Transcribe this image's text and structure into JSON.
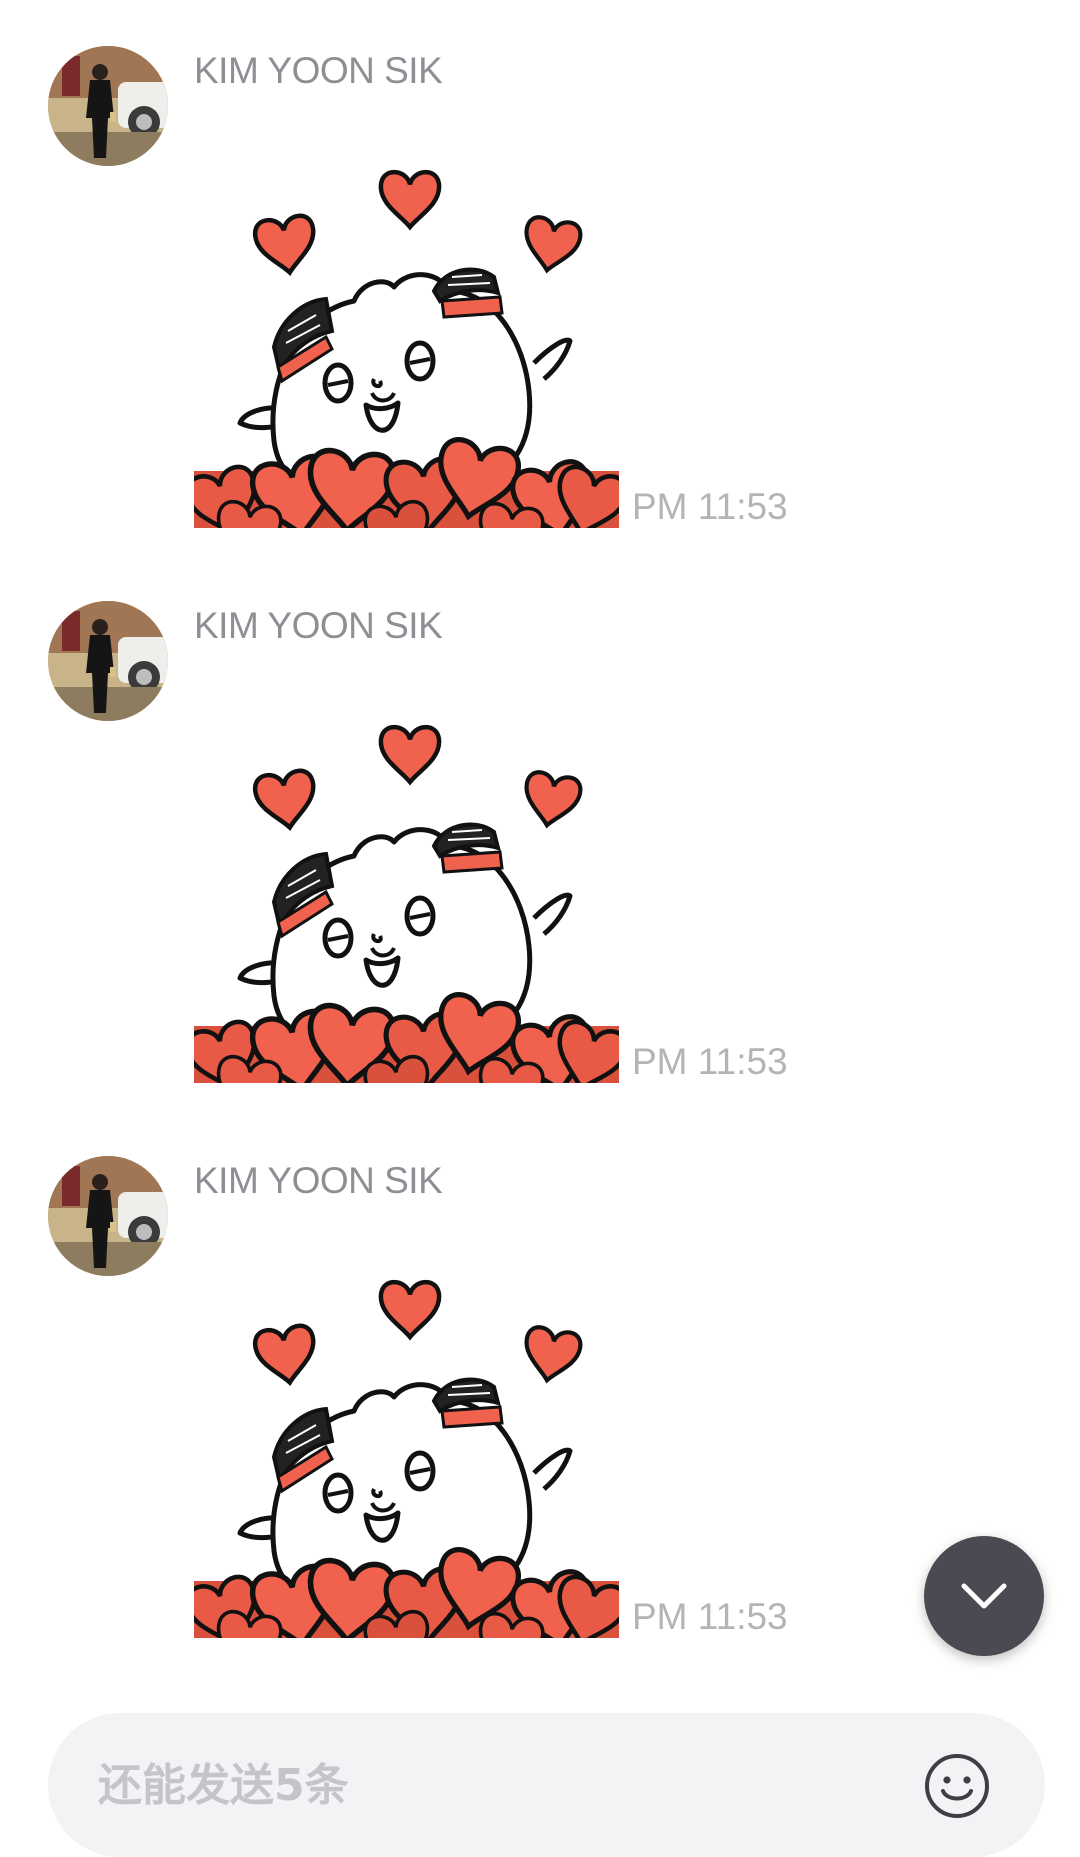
{
  "messages": [
    {
      "sender": "KIM YOON SIK",
      "type": "sticker",
      "sticker_icon": "heart-bear-sticker",
      "time": "PM 11:53"
    },
    {
      "sender": "KIM YOON SIK",
      "type": "sticker",
      "sticker_icon": "heart-bear-sticker",
      "time": "PM 11:53"
    },
    {
      "sender": "KIM YOON SIK",
      "type": "sticker",
      "sticker_icon": "heart-bear-sticker",
      "time": "PM 11:53"
    }
  ],
  "composer": {
    "placeholder": "还能发送5条",
    "value": ""
  },
  "icons": {
    "scroll_down": "chevron-down-icon",
    "emoji": "smiley-face-icon"
  },
  "colors": {
    "heart_red": "#f0624d",
    "heart_dark": "#d9503d",
    "sender_gray": "#8e8e94",
    "time_gray": "#b4b4b8",
    "fab_dark": "#4a4b52",
    "composer_bg": "#f2f3f5"
  }
}
